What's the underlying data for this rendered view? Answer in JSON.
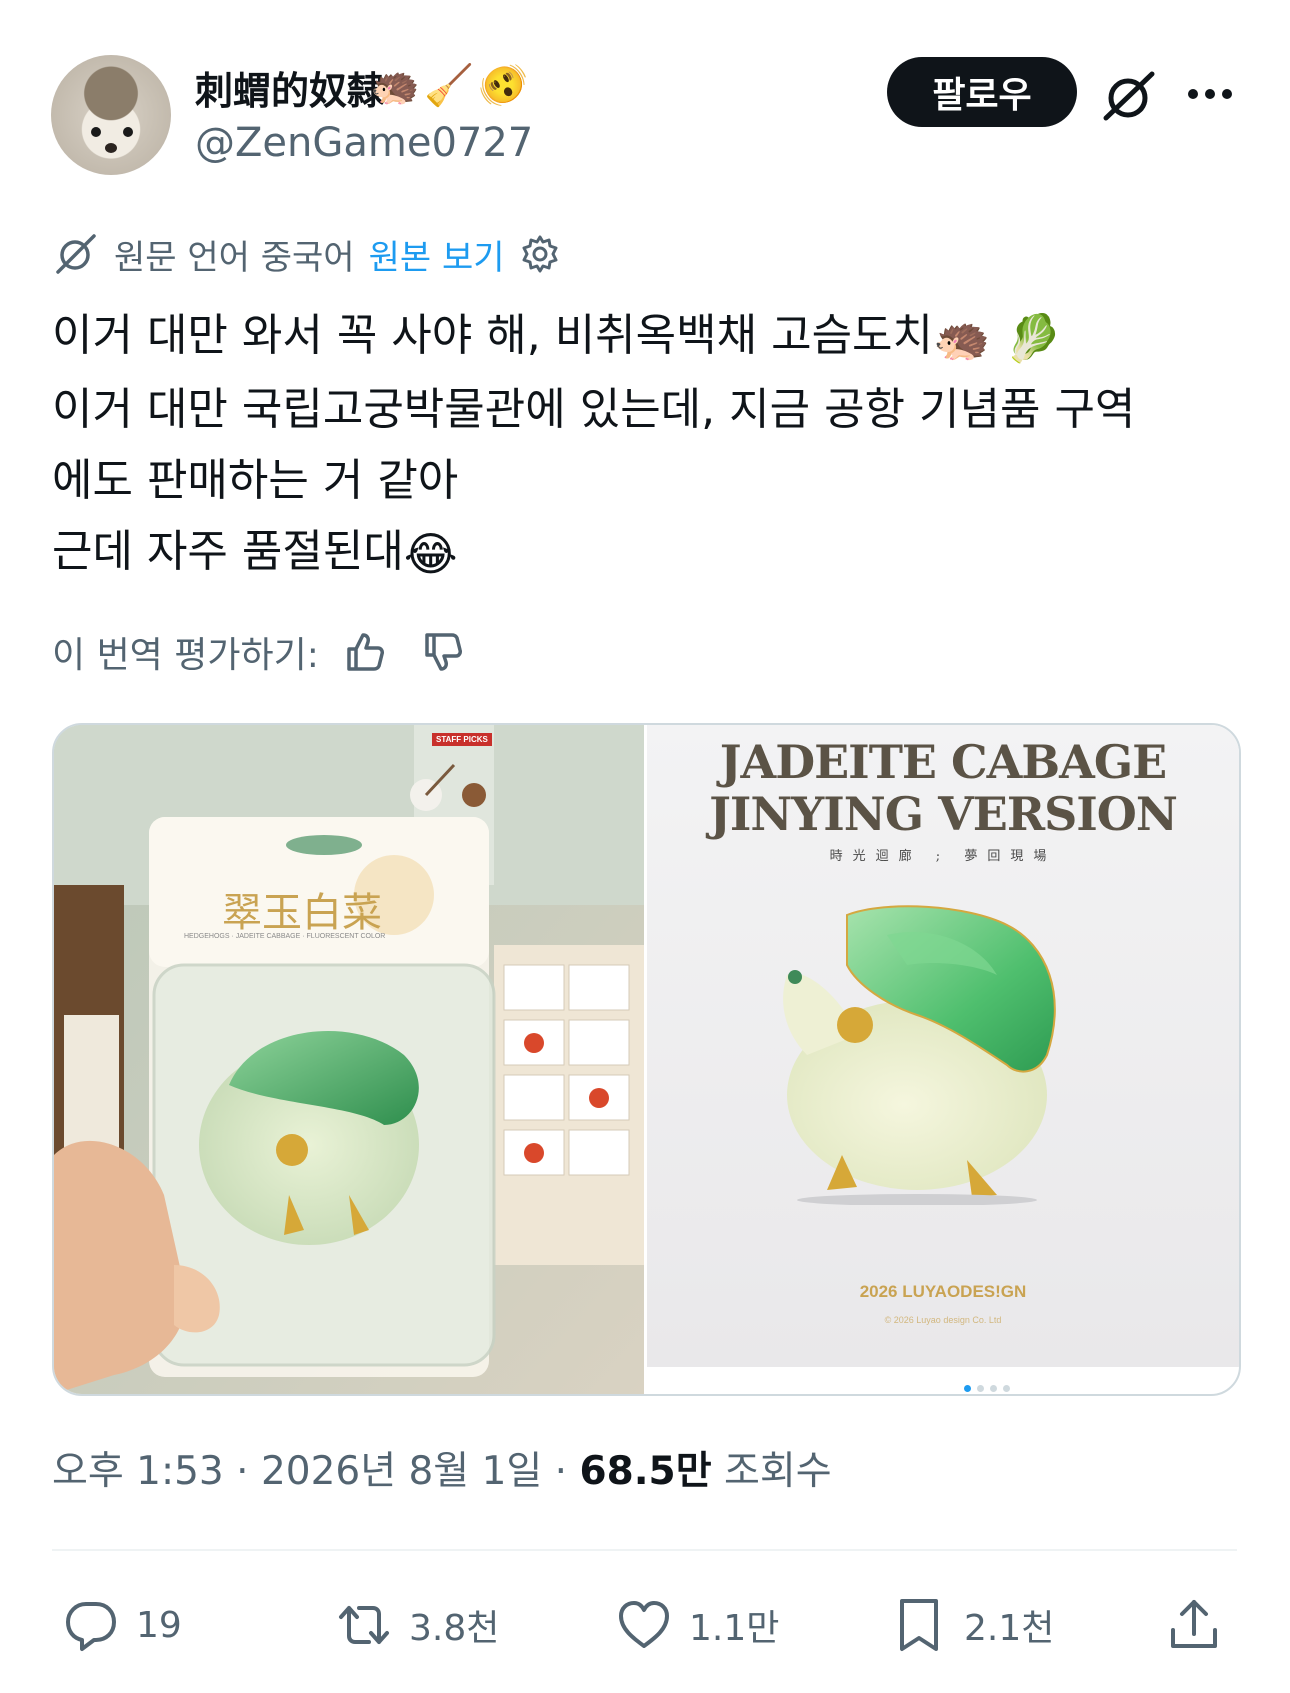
{
  "header": {
    "display_name": "刺蝟的奴隸",
    "name_emojis": [
      "🦔",
      "🧹",
      "🫨"
    ],
    "handle": "@ZenGame0727",
    "follow_label": "팔로우",
    "icons": {
      "grok": "grok-icon",
      "more": "more-dots-icon"
    }
  },
  "translation": {
    "language_note": "원문 언어 중국어",
    "show_original": "원본 보기",
    "icons": {
      "translate": "grok-icon",
      "settings": "gear-icon"
    }
  },
  "body": {
    "lines": [
      {
        "text": "이거 대만 와서 꼭 사야 해, 비취옥백채 고슴도치",
        "emojis": "🦔 🥬"
      },
      {
        "text": "이거 대만 국립고궁박물관에 있는데, 지금 공항 기념품 구역",
        "emojis": ""
      },
      {
        "text": "에도 판매하는 거 같아",
        "emojis": ""
      },
      {
        "text": "근데 자주 품절된대",
        "emojis": "😂"
      }
    ]
  },
  "rating": {
    "label": "이 번역 평가하기:",
    "icons": [
      "thumbs-up-icon",
      "thumbs-down-icon"
    ]
  },
  "media": {
    "left_photo": {
      "box_title": "翠玉白菜",
      "box_subtitle": "HEDGEHOGS · JADEITE CABBAGE · FLUORESCENT COLOR",
      "staff_badge": "STAFF PICKS"
    },
    "right_photo": {
      "title_line1": "JADEITE CABAGE",
      "title_line2": "JINYING VERSION",
      "subtitle": "時光迴廊 ; 夢回現場",
      "brand": "2026  LUYAODES!GN",
      "copyright": "© 2026 Luyao design Co. Ltd"
    },
    "page_indicator": {
      "count": 4,
      "active": 0
    }
  },
  "meta": {
    "time": "오후 1:53",
    "date": "2026년 8월 1일",
    "views_count": "68.5만",
    "views_label": "조회수"
  },
  "actions": {
    "replies": "19",
    "reposts": "3.8천",
    "likes": "1.1만",
    "bookmarks": "2.1천"
  },
  "colors": {
    "text_primary": "#0f1419",
    "text_secondary": "#536471",
    "link": "#1d9bf0",
    "follow_bg": "#0f1419",
    "border": "#cfd9de",
    "separator": "#eff3f4"
  }
}
